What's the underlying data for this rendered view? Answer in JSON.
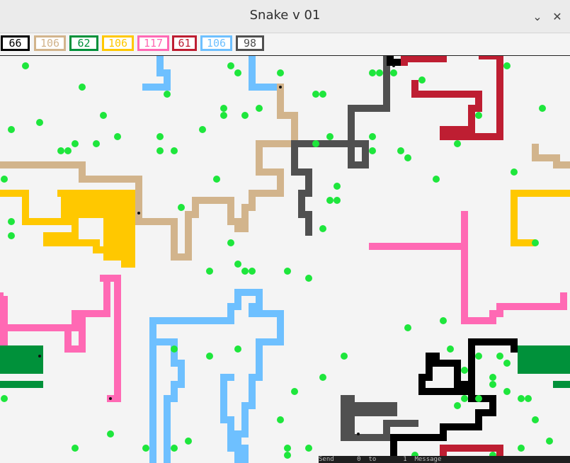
{
  "window": {
    "title": "Snake v 01"
  },
  "window_controls": [
    {
      "icon": "chevron-down-icon",
      "glyph": "⌄"
    },
    {
      "icon": "close-icon",
      "glyph": "✕"
    }
  ],
  "scores": [
    {
      "value": "66",
      "color": "#000000"
    },
    {
      "value": "106",
      "color": "#d2b48c"
    },
    {
      "value": "62",
      "color": "#00913a"
    },
    {
      "value": "106",
      "color": "#ffc800"
    },
    {
      "value": "117",
      "color": "#ff69b4"
    },
    {
      "value": "61",
      "color": "#be1e32"
    },
    {
      "value": "106",
      "color": "#6ec0ff"
    },
    {
      "value": "98",
      "color": "#505050"
    }
  ],
  "colors": {
    "food": "#1ee63c",
    "background": "#f4f4f4"
  },
  "status_strip": "Send      0  to       1  Message"
}
